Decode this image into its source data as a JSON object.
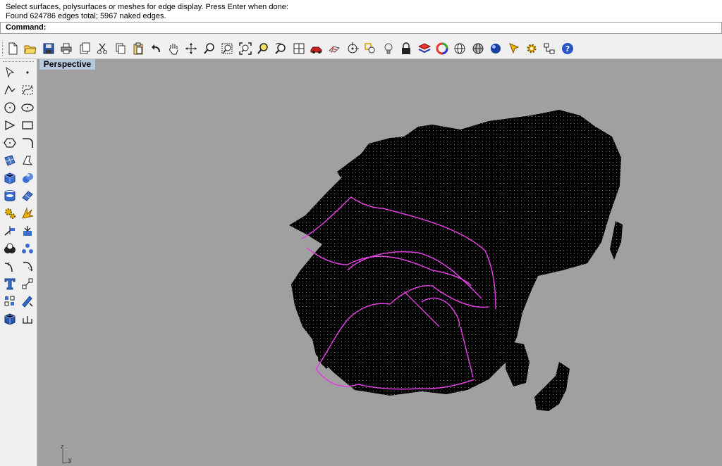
{
  "command_history": {
    "lines": [
      "Select surfaces, polysurfaces or meshes for edge display. Press Enter when done:",
      "Found 624786 edges total; 5967 naked edges."
    ]
  },
  "command_prompt": {
    "label": "Command:"
  },
  "viewport": {
    "tab_label": "Perspective",
    "background_color": "#a0a0a0",
    "mesh_color": "#000000",
    "naked_edge_color": "#e040e0",
    "axes": {
      "z_label": "z",
      "y_label": "y"
    }
  },
  "toolbar": {
    "icons": [
      "new-icon",
      "open-icon",
      "save-icon",
      "print-icon",
      "export-icon",
      "cut-icon",
      "copy-icon",
      "paste-icon",
      "undo-icon",
      "pan-icon",
      "rotate-view-icon",
      "zoom-icon",
      "zoom-window-icon",
      "zoom-extents-icon",
      "zoom-selected-icon",
      "undo-view-icon",
      "four-viewports-icon",
      "car-render-icon",
      "grid-plane-icon",
      "snap-icon",
      "point-icon",
      "light-bulb-icon",
      "lock-icon",
      "layer-icon",
      "color-wheel-icon",
      "wireframe-sphere-icon",
      "shaded-sphere-icon",
      "render-sphere-icon",
      "select-arrow-icon",
      "settings-gear-icon",
      "properties-icon",
      "help-icon"
    ]
  },
  "sidebar": {
    "icons": [
      "select-arrow-icon",
      "point-icon",
      "polyline-icon",
      "curve-icon",
      "circle-icon",
      "ellipse-icon",
      "arc-icon",
      "rectangle-icon",
      "polygon-icon",
      "fillet-icon",
      "surface-icon",
      "network-surface-icon",
      "box-icon",
      "sphere-icon",
      "cylinder-icon",
      "extrude-icon",
      "gear-icon",
      "burst-icon",
      "split-icon",
      "trim-icon",
      "boolean-icon",
      "explode-icon",
      "offset-icon",
      "rotate-icon",
      "text-icon",
      "scale-icon",
      "array-icon",
      "analyze-icon",
      "solid-box-icon",
      "dimension-icon"
    ]
  }
}
